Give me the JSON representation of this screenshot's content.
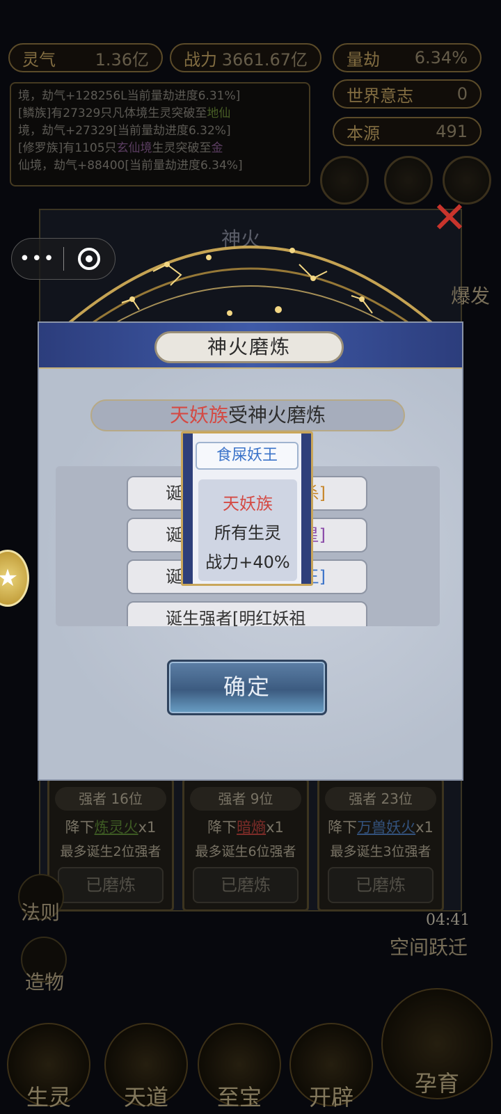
{
  "top_stats": {
    "lingqi_label": "灵气",
    "lingqi_value": "1.36亿",
    "zhanli_label": "战力",
    "zhanli_value": "3661.67亿",
    "liangjie_label": "量劫",
    "liangjie_value": "6.34%",
    "world_will_label": "世界意志",
    "world_will_value": "0",
    "benyuan_label": "本源",
    "benyuan_value": "491"
  },
  "log_lines": [
    {
      "text": "境，劫气+128256L当前量劫进度6.31%]"
    },
    {
      "prefix": "[鳞族]有27329只凡体境生灵突破至",
      "highlight": "地仙",
      "color": "green"
    },
    {
      "text": "境，劫气+27329[当前量劫进度6.32%]"
    },
    {
      "prefix": "[修罗族]有1105只",
      "highlight": "玄仙境",
      "suffix": "生灵突破至",
      "highlight2": "金",
      "color": "purple"
    },
    {
      "text": "仙境，劫气+88400[当前量劫进度6.34%]"
    }
  ],
  "under_panel": {
    "title": "神火",
    "right_label_burst": "爆发",
    "cards": [
      {
        "rank": "强者 16位",
        "drop_prefix": "降下",
        "fire": "炼灵火",
        "drop_suffix": "x1",
        "max": "最多诞生2位强者",
        "button": "已磨炼"
      },
      {
        "rank": "强者 9位",
        "drop_prefix": "降下",
        "fire": "暗熵",
        "drop_suffix": "x1",
        "max": "最多诞生6位强者",
        "button": "已磨炼"
      },
      {
        "rank": "强者 23位",
        "drop_prefix": "降下",
        "fire": "万兽妖火",
        "drop_suffix": "x1",
        "max": "最多诞生3位强者",
        "button": "已磨炼"
      }
    ]
  },
  "side_labels": {
    "fa_ze": "法则",
    "zao_wu": "造物",
    "space_jump": "空间跃迁",
    "timer": "04:41"
  },
  "bottom_nav": [
    "生灵",
    "天道",
    "至宝",
    "开辟",
    "孕育"
  ],
  "modal": {
    "title": "神火磨炼",
    "subtitle_race": "天妖族",
    "subtitle_rest": "受神火磨炼",
    "list": [
      {
        "text": "诞",
        "tail": "杀]"
      },
      {
        "text": "诞",
        "tail": "星]"
      },
      {
        "text": "诞",
        "tail": "王]"
      },
      {
        "text": "诞生强者[明红妖祖",
        "tail": ""
      }
    ],
    "confirm": "确定"
  },
  "tooltip": {
    "title": "食屎妖王",
    "race": "天妖族",
    "target": "所有生灵",
    "effect": "战力+40%"
  },
  "colors": {
    "accent_gold": "#c9a65a",
    "header_blue": "#2c3d7c",
    "race_red": "#d44a44"
  }
}
